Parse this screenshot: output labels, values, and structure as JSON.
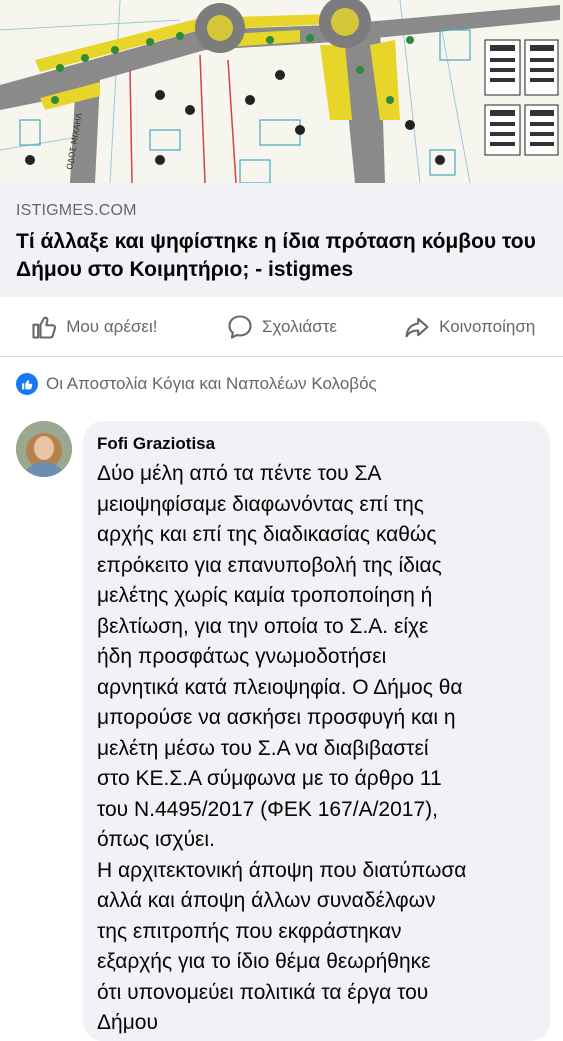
{
  "link_preview": {
    "domain": "ISTIGMES.COM",
    "title": "Τί άλλαξε και ψηφίστηκε η ίδια πρόταση κόμβου του Δήμου στο Κοιμητήριο; - istigmes",
    "image_label": "ΟΔΟΣ ΜΙΧΑΗΛ"
  },
  "actions": {
    "like": "Μου αρέσει!",
    "comment": "Σχολιάστε",
    "share": "Κοινοποίηση"
  },
  "reactions": {
    "text": "Οι Αποστολία Κόγια και Ναπολέων Κολοβός"
  },
  "comment": {
    "author": "Fofi Graziotisa",
    "text": "Δύο μέλη από τα πέντε του ΣΑ\nμειοψηφίσαμε διαφωνόντας επί της\nαρχής και επί της διαδικασίας καθώς\nεπρόκειτο για επανυποβολή της ίδιας\nμελέτης χωρίς καμία τροποποίηση ή\nβελτίωση, για την οποία το Σ.Α. είχε\nήδη προσφάτως γνωμοδοτήσει\nαρνητικά κατά πλειοψηφία. Ο Δήμος θα\nμπορούσε να ασκήσει προσφυγή και η\nμελέτη μέσω του Σ.Α να διαβιβαστεί\nστο ΚΕ.Σ.Α σύμφωνα με το άρθρο 11\nτου Ν.4495/2017 (ΦΕΚ 167/Α/2017),\nόπως ισχύει.\nΗ αρχιτεκτονική άποψη που διατύπωσα\nαλλά και άποψη άλλων συναδέλφων\nτης επιτροπής που εκφράστηκαν\nεξαρχής για το ίδιο θέμα θεωρήθηκε\nότι υπονομεύει πολιτικά τα έργα του\nΔήμου"
  },
  "colors": {
    "fb_blue": "#1877f2",
    "secondary_text": "#65676b",
    "bubble_bg": "#f0f2f5"
  },
  "icons": [
    "thumbs-up-icon",
    "comment-icon",
    "share-icon",
    "like-badge-icon"
  ]
}
